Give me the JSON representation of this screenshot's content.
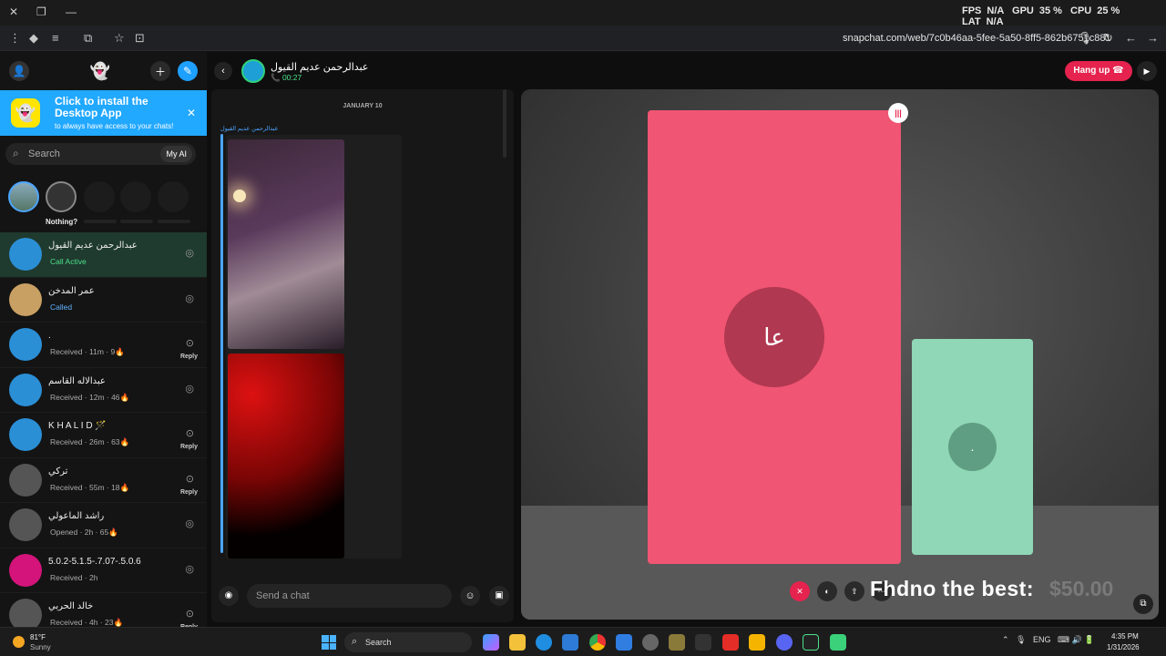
{
  "overlay_stats": {
    "fps_label": "FPS",
    "fps": "N/A",
    "gpu_label": "GPU",
    "gpu": "35 %",
    "cpu_label": "CPU",
    "cpu": "25 %",
    "lat_label": "LAT",
    "lat": "N/A"
  },
  "browser": {
    "url": "snapchat.com/web/7c0b46aa-5fee-5a50-8ff5-862b6751c881"
  },
  "install_banner": {
    "title": "Click to install the Desktop App",
    "subtitle": "to always have access to your chats!"
  },
  "search": {
    "placeholder": "Search",
    "my_ai": "My AI"
  },
  "stories": {
    "label": "Nothing?"
  },
  "chats": [
    {
      "name": "عبدالرحمن عديم القيول",
      "status": "Call Active",
      "status_type": "green",
      "avatar_color": "#2b8fd6",
      "action": "◎"
    },
    {
      "name": "عمر المدخن",
      "status": "Called",
      "status_type": "blue",
      "avatar_color": "#c9a063",
      "action": "◎"
    },
    {
      "name": ".",
      "status": "Received · 11m · 9🔥",
      "status_type": "grey",
      "avatar_color": "#2b8fd6",
      "action": "⊙",
      "reply": "Reply"
    },
    {
      "name": "عبدالاله القاسم",
      "status": "Received · 12m · 46🔥",
      "status_type": "grey",
      "avatar_color": "#2b8fd6",
      "action": "◎"
    },
    {
      "name": "K H A L I D 🪄",
      "status": "Received · 26m · 63🔥",
      "status_type": "grey",
      "avatar_color": "#2b8fd6",
      "action": "⊙",
      "reply": "Reply"
    },
    {
      "name": "تركي",
      "status": "Received · 55m · 18🔥",
      "status_type": "grey",
      "avatar_color": "#555555",
      "action": "⊙",
      "reply": "Reply"
    },
    {
      "name": "راشد الماعولي",
      "status": "Opened · 2h · 65🔥",
      "status_type": "grey",
      "avatar_color": "#555555",
      "action": "◎"
    },
    {
      "name": "5.0.2-5.1.5-.7.07-.5.0.6",
      "status": "Received · 2h",
      "status_type": "grey",
      "avatar_color": "#d4147a",
      "action": "◎"
    },
    {
      "name": "خالد الحربي",
      "status": "Received · 4h · 23🔥",
      "status_type": "grey",
      "avatar_color": "#555555",
      "action": "⊙",
      "reply": "Reply"
    }
  ],
  "chat_header": {
    "name": "عبدالرحمن عديم القيول",
    "timer": "00:27",
    "hangup": "Hang up"
  },
  "messages": {
    "date": "JANUARY 10",
    "sender": "عبدالرحمن عديم القيول"
  },
  "composer": {
    "placeholder": "Send a chat"
  },
  "video": {
    "main_initials": "عا",
    "side_initials": ".",
    "overlay_text": "Fhdno the best:",
    "overlay_amount": "$50.00"
  },
  "taskbar": {
    "temp": "81°F",
    "condition": "Sunny",
    "search": "Search",
    "lang": "ENG",
    "time": "4:35 PM",
    "date": "1/31/2026"
  }
}
